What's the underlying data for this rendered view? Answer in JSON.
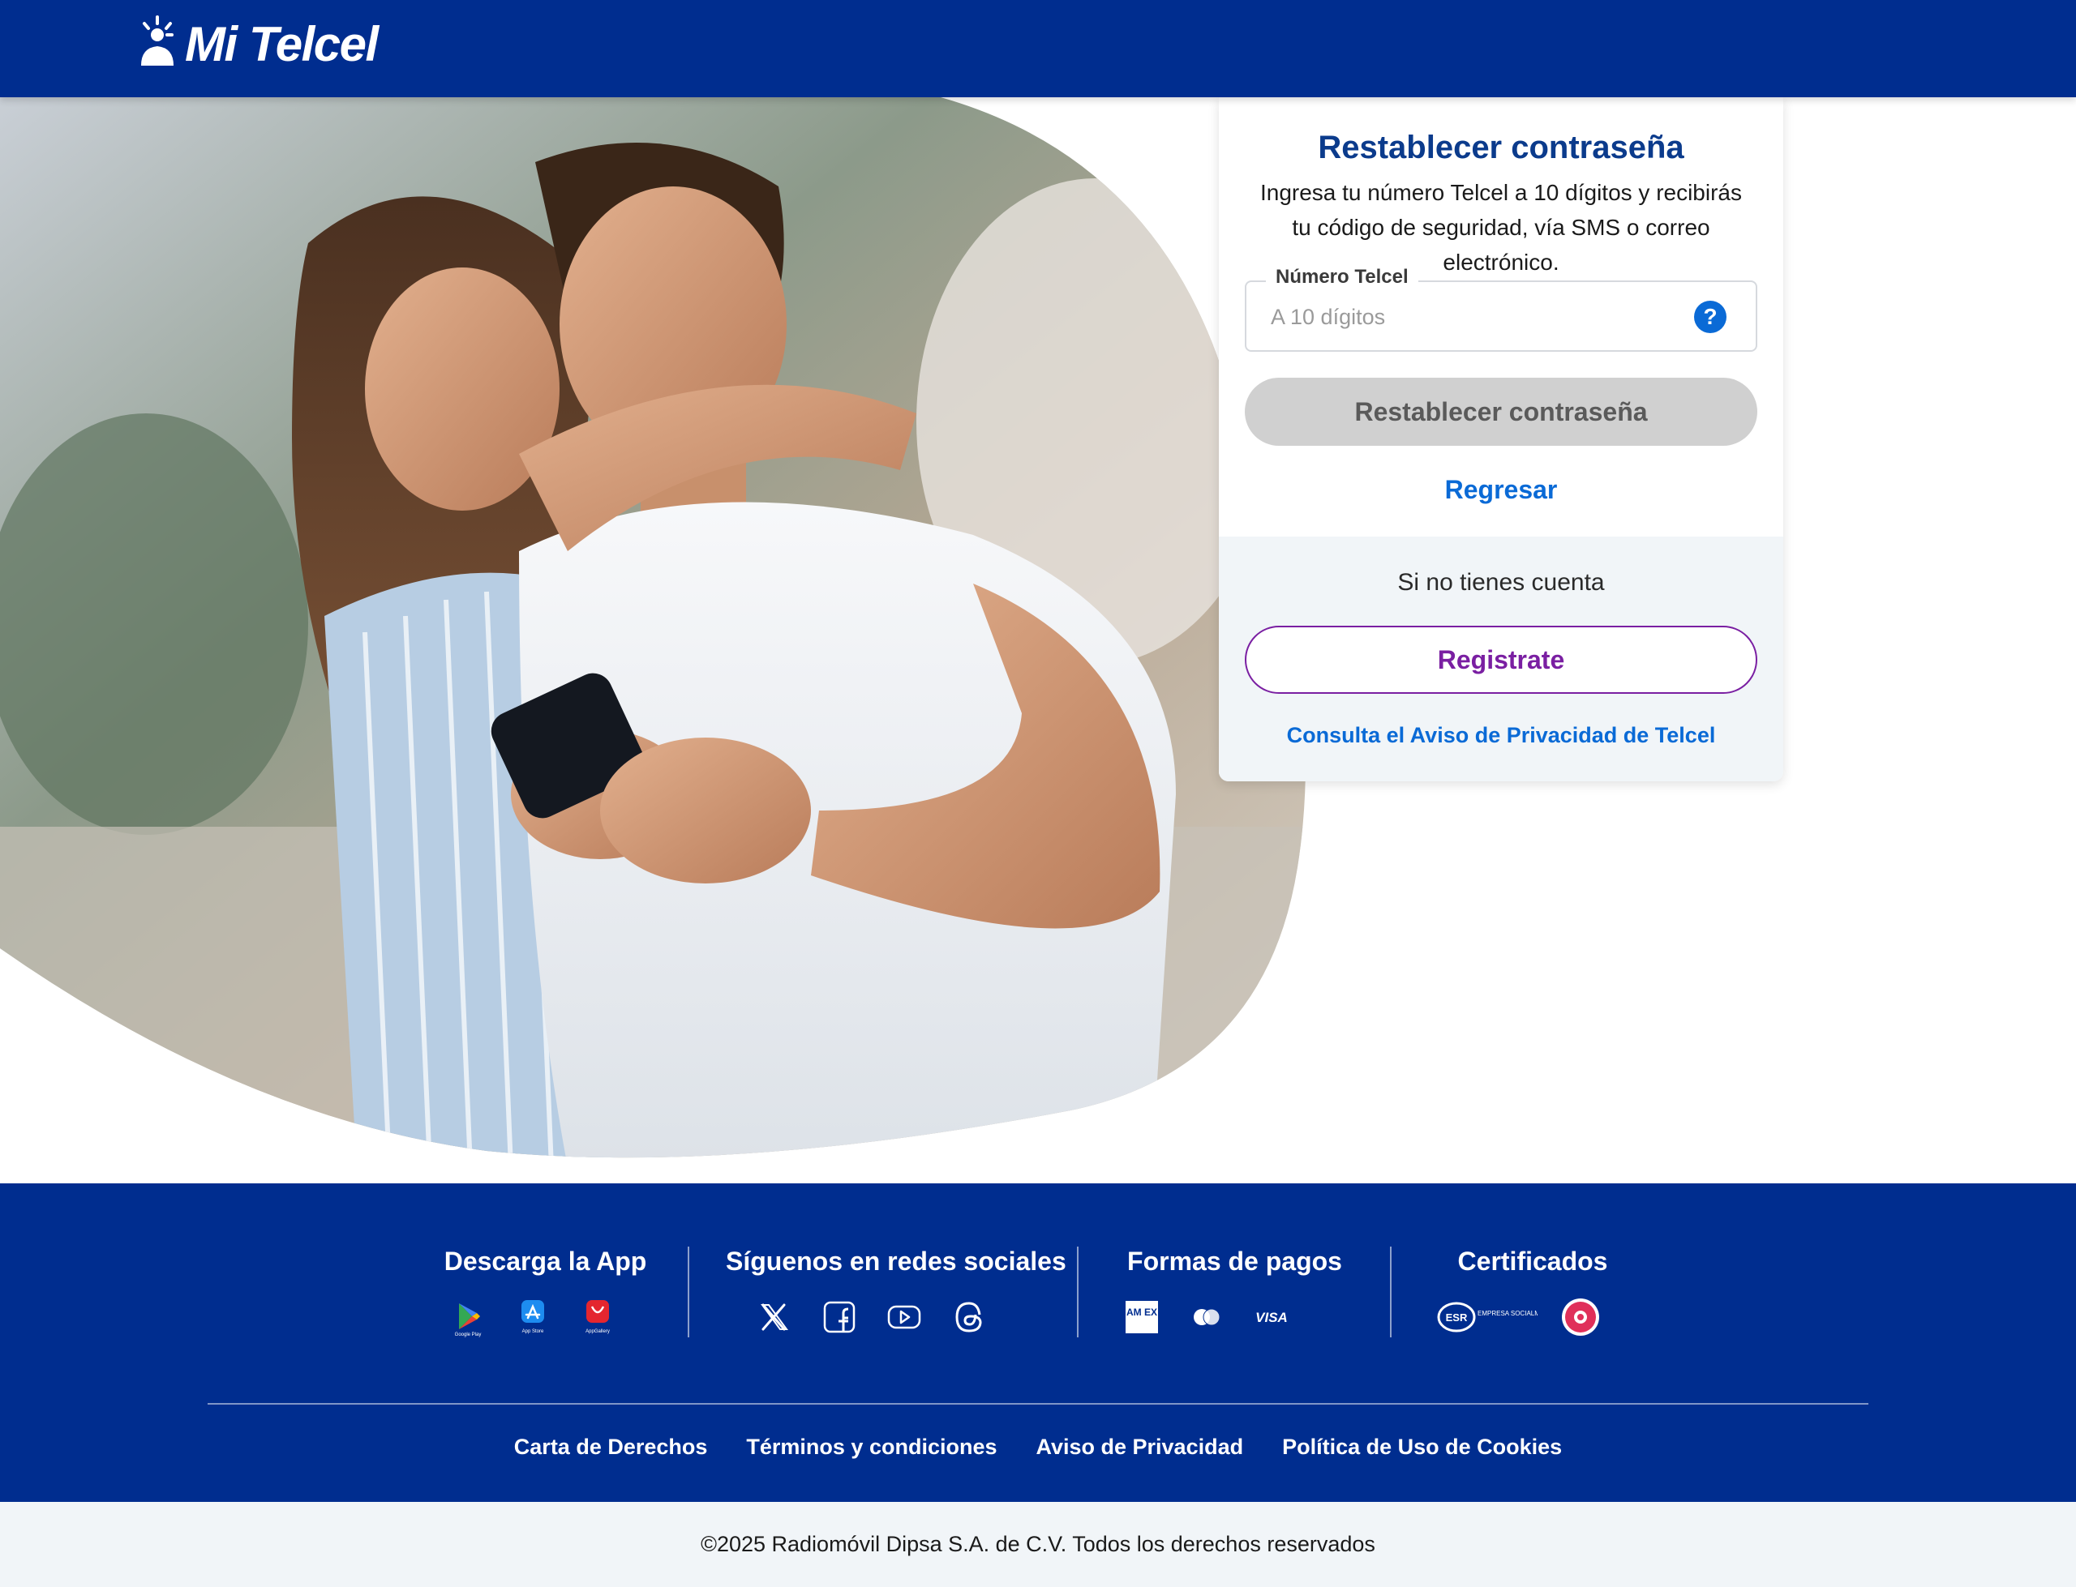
{
  "header": {
    "logo_text": "Mi Telcel",
    "logo_icon": "telcel-person-icon"
  },
  "hero": {
    "image_alt": "couple-smartphone-photo"
  },
  "card": {
    "title": "Restablecer contraseña",
    "description": "Ingresa tu número Telcel a 10 dígitos y recibirás tu código de seguridad, vía SMS o correo electrónico.",
    "field_label": "Número Telcel",
    "field_placeholder": "A 10 dígitos",
    "field_value": "",
    "help_icon": "question-icon",
    "reset_button": "Restablecer contraseña",
    "back_link": "Regresar",
    "no_account_text": "Si no tienes cuenta",
    "register_button": "Registrate",
    "privacy_link": "Consulta el Aviso de Privacidad de Telcel"
  },
  "footer": {
    "app_title": "Descarga la App",
    "app_stores": [
      {
        "name": "google-play-icon",
        "label": "Google Play"
      },
      {
        "name": "app-store-icon",
        "label": "App Store"
      },
      {
        "name": "app-gallery-icon",
        "label": "AppGallery"
      }
    ],
    "social_title": "Síguenos en redes sociales",
    "social": [
      "x-icon",
      "facebook-icon",
      "youtube-icon",
      "threads-icon"
    ],
    "payments_title": "Formas de pagos",
    "payments": [
      "amex-icon",
      "mastercard-icon",
      "visa-icon"
    ],
    "visa_label": "VISA",
    "amex_label": "AM EX",
    "certs_title": "Certificados",
    "certs": [
      "esr-icon",
      "distintivo-icon"
    ],
    "esr_label": "ESR",
    "esr_text": "EMPRESA SOCIALMENTE RESPONSABLE",
    "links": [
      "Carta de Derechos",
      "Términos y condiciones",
      "Aviso de Privacidad",
      "Política de Uso de Cookies"
    ]
  },
  "copyright": "©2025 Radiomóvil Dipsa S.A. de C.V. Todos los derechos reservados",
  "colors": {
    "brand_blue": "#002d8f",
    "title_blue": "#0b3b8c",
    "link_blue": "#0a6ad6",
    "register_purple": "#7a1fa2",
    "disabled_gray": "#d0d0d0",
    "footer_bg": "#002d8f",
    "copyright_bg": "#f1f5f8"
  }
}
